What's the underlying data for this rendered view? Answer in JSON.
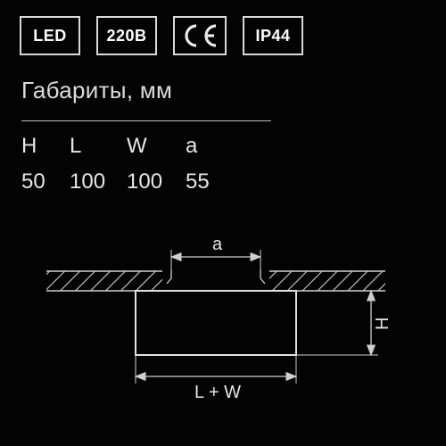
{
  "badges": {
    "led": "LED",
    "voltage": "220B",
    "ce": "CE",
    "ip": "IP44"
  },
  "section_title": "Габариты, мм",
  "dims": {
    "headers": {
      "H": "H",
      "L": "L",
      "W": "W",
      "a": "a"
    },
    "values": {
      "H": "50",
      "L": "100",
      "W": "100",
      "a": "55"
    }
  },
  "diagram": {
    "label_a": "a",
    "label_H": "H",
    "label_LW": "L + W"
  }
}
